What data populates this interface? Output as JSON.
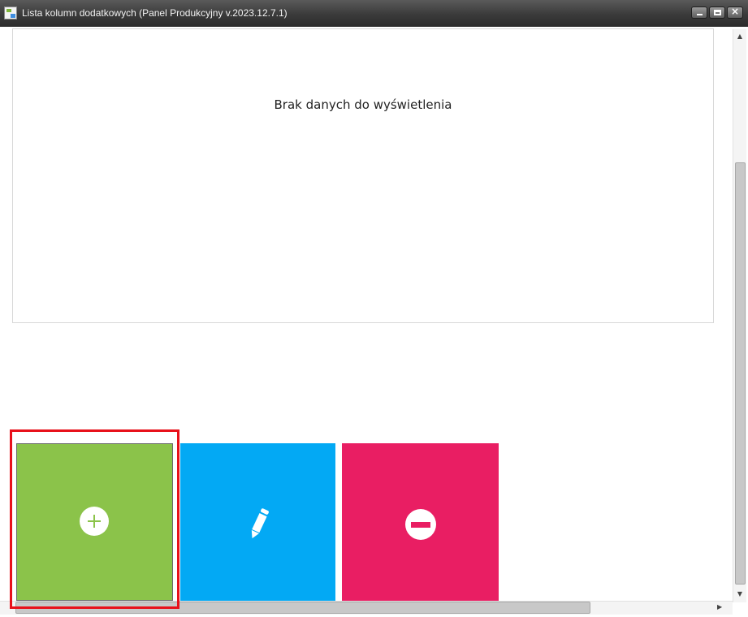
{
  "window": {
    "title": "Lista kolumn dodatkowych (Panel Produkcyjny v.2023.12.7.1)",
    "icon": "app-logo-icon",
    "controls": [
      "minimize-icon",
      "maximize-icon",
      "close-icon"
    ]
  },
  "grid": {
    "empty_message": "Brak danych do wyświetlenia"
  },
  "actions": [
    {
      "name": "add",
      "icon": "plus-circle-icon",
      "color": "#8bc34a",
      "highlighted": true
    },
    {
      "name": "edit",
      "icon": "pencil-icon",
      "color": "#03a9f4"
    },
    {
      "name": "remove",
      "icon": "minus-circle-icon",
      "color": "#e91e63"
    }
  ],
  "colors": {
    "highlight": "#e8101a",
    "titlebar": "#3a3a3a"
  }
}
